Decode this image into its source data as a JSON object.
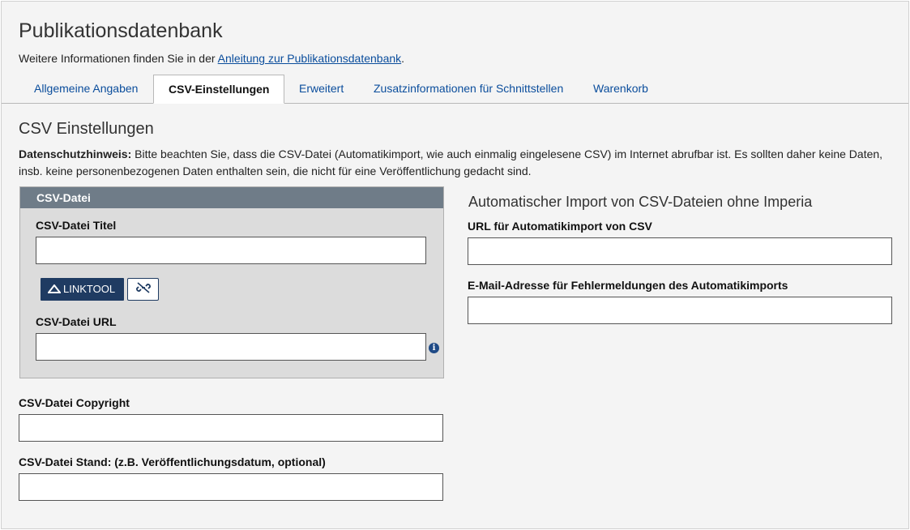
{
  "header": {
    "title": "Publikationsdatenbank",
    "info_prefix": "Weitere Informationen finden Sie in der ",
    "info_link": "Anleitung zur Publikationsdatenbank",
    "info_suffix": "."
  },
  "tabs": [
    {
      "label": "Allgemeine Angaben",
      "active": false
    },
    {
      "label": "CSV-Einstellungen",
      "active": true
    },
    {
      "label": "Erweitert",
      "active": false
    },
    {
      "label": "Zusatzinformationen für Schnittstellen",
      "active": false
    },
    {
      "label": "Warenkorb",
      "active": false
    }
  ],
  "section": {
    "title": "CSV Einstellungen",
    "privacy_label": "Datenschutzhinweis:",
    "privacy_text": " Bitte beachten Sie, dass die CSV-Datei (Automatikimport, wie auch einmalig eingelesene CSV) im Internet abrufbar ist. Es sollten daher keine Daten, insb. keine personenbezogenen Daten enthalten sein, die nicht für eine Veröffentlichung gedacht sind."
  },
  "csv_panel": {
    "heading": "CSV-Datei",
    "title_label": "CSV-Datei Titel",
    "title_value": "",
    "linktool_label": "LINKTOOL",
    "url_label": "CSV-Datei URL",
    "url_value": "",
    "info_icon": "i"
  },
  "copyright": {
    "label": "CSV-Datei Copyright",
    "value": ""
  },
  "stand": {
    "label": "CSV-Datei Stand: (z.B. Veröffentlichungsdatum, optional)",
    "value": ""
  },
  "auto_import": {
    "title": "Automatischer Import von CSV-Dateien ohne Imperia",
    "url_label": "URL für Automatikimport von CSV",
    "url_value": "",
    "email_label": "E-Mail-Adresse für Fehlermeldungen des Automatikimports",
    "email_value": ""
  },
  "icons": {
    "linktool": "mountain-icon",
    "unlink": "unlink-icon",
    "info": "info-icon"
  },
  "colors": {
    "link": "#0a4d9c",
    "panel_header": "#6f7c88",
    "button_primary": "#1f3b62"
  }
}
